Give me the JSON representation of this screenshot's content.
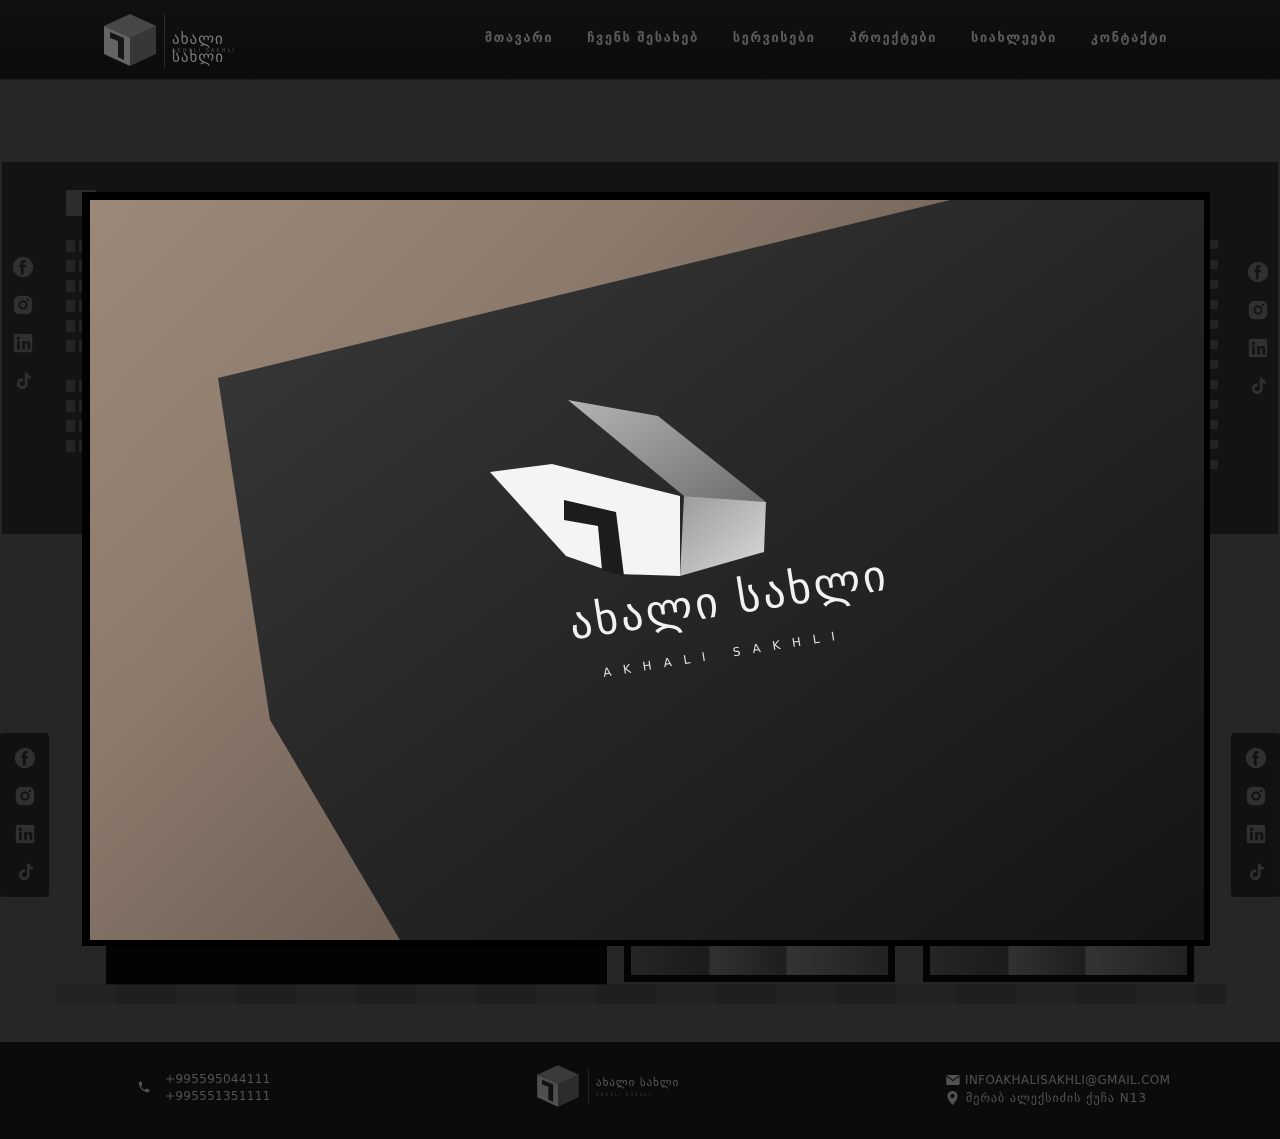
{
  "brand": {
    "logo_text": "ახალი სახლი",
    "logo_sub": "AKHALI SAKHLI"
  },
  "nav": {
    "items": [
      {
        "label": "მთავარი"
      },
      {
        "label": "ჩვენს შესახებ"
      },
      {
        "label": "სერვისები"
      },
      {
        "label": "პროექტები"
      },
      {
        "label": "სიახლეები"
      },
      {
        "label": "კონტაქტი"
      }
    ]
  },
  "social": {
    "icons": [
      "facebook-icon",
      "instagram-icon",
      "linkedin-icon",
      "tiktok-icon"
    ]
  },
  "modal": {
    "logo_title": "ახალი სახლი",
    "logo_sub": "AKHALI SAKHLI"
  },
  "footer": {
    "phone1": "+995595044111",
    "phone2": "+995551351111",
    "email": "INFOAKHALISAKHLI@GMAIL.COM",
    "address": "მერაბ ალექსიძის ქუჩა N13"
  },
  "colors": {
    "header_bg": "#141414",
    "page_bg": "#3b3b3b",
    "footer_bg": "#121212",
    "accent_text": "#8a8a8a"
  }
}
